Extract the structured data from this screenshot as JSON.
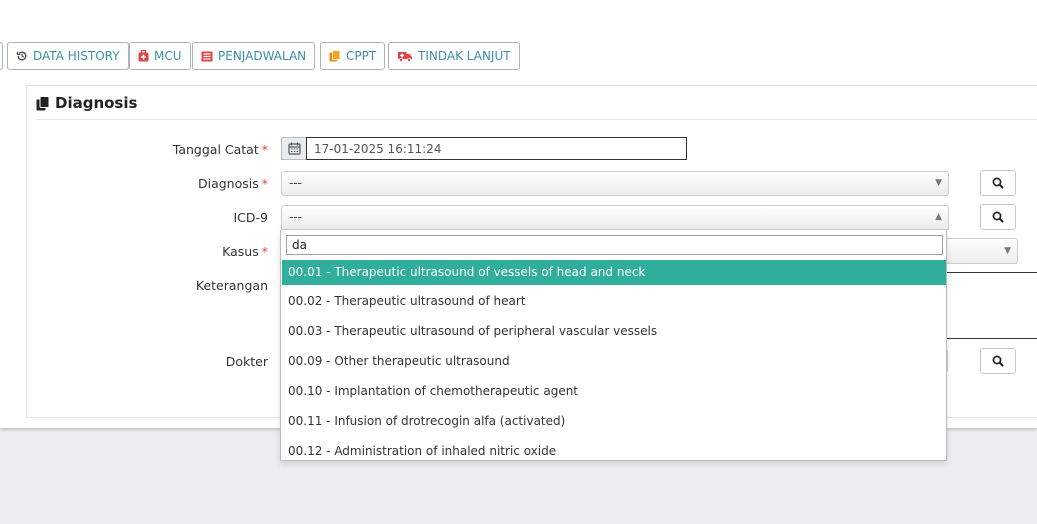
{
  "toolbar": {
    "buttons": [
      {
        "label": "DATA HISTORY",
        "icon": "history-icon"
      },
      {
        "label": "MCU",
        "icon": "medkit-icon"
      },
      {
        "label": "PENJADWALAN",
        "icon": "list-icon"
      },
      {
        "label": "CPPT",
        "icon": "copy-icon"
      },
      {
        "label": "TINDAK LANJUT",
        "icon": "ambulance-icon"
      }
    ]
  },
  "panel": {
    "title": "Diagnosis",
    "title_icon": "files-icon"
  },
  "form": {
    "tanggal_label": "Tanggal Catat",
    "tanggal_value": "17-01-2025 16:11:24",
    "diagnosis_label": "Diagnosis",
    "diagnosis_value": "---",
    "icd9_label": "ICD-9",
    "icd9_value": "---",
    "kasus_label": "Kasus",
    "keterangan_label": "Keterangan",
    "dokter_label": "Dokter",
    "required_mark": "*"
  },
  "dropdown": {
    "search_value": "da",
    "options": [
      "00.01 - Therapeutic ultrasound of vessels of head and neck",
      "00.02 - Therapeutic ultrasound of heart",
      "00.03 - Therapeutic ultrasound of peripheral vascular vessels",
      "00.09 - Other therapeutic ultrasound",
      "00.10 - Implantation of chemotherapeutic agent",
      "00.11 - Infusion of drotrecogin alfa (activated)",
      "00.12 - Administration of inhaled nitric oxide"
    ],
    "active_index": 0
  },
  "colors": {
    "accent_teal": "#30ae9c",
    "button_text": "#3b8fa8",
    "required_red": "#e04343",
    "icon_red": "#e04343",
    "icon_orange": "#f08a18"
  }
}
